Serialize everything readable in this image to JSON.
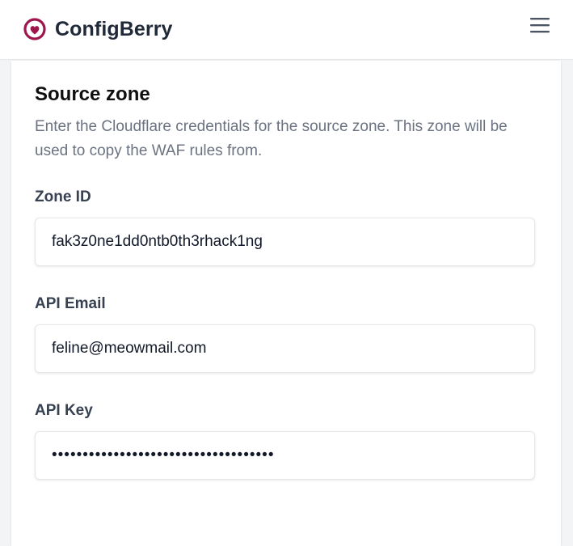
{
  "header": {
    "brand_name": "ConfigBerry",
    "brand_color": "#9d174d",
    "menu_icon": "hamburger-menu-icon"
  },
  "section": {
    "title": "Source zone",
    "description": "Enter the Cloudflare credentials for the source zone. This zone will be used to copy the WAF rules from."
  },
  "fields": {
    "zone_id": {
      "label": "Zone ID",
      "value": "fak3z0ne1dd0ntb0th3rhack1ng"
    },
    "api_email": {
      "label": "API Email",
      "value": "feline@meowmail.com"
    },
    "api_key": {
      "label": "API Key",
      "value": "••••••••••••••••••••••••••••••••••••"
    }
  }
}
